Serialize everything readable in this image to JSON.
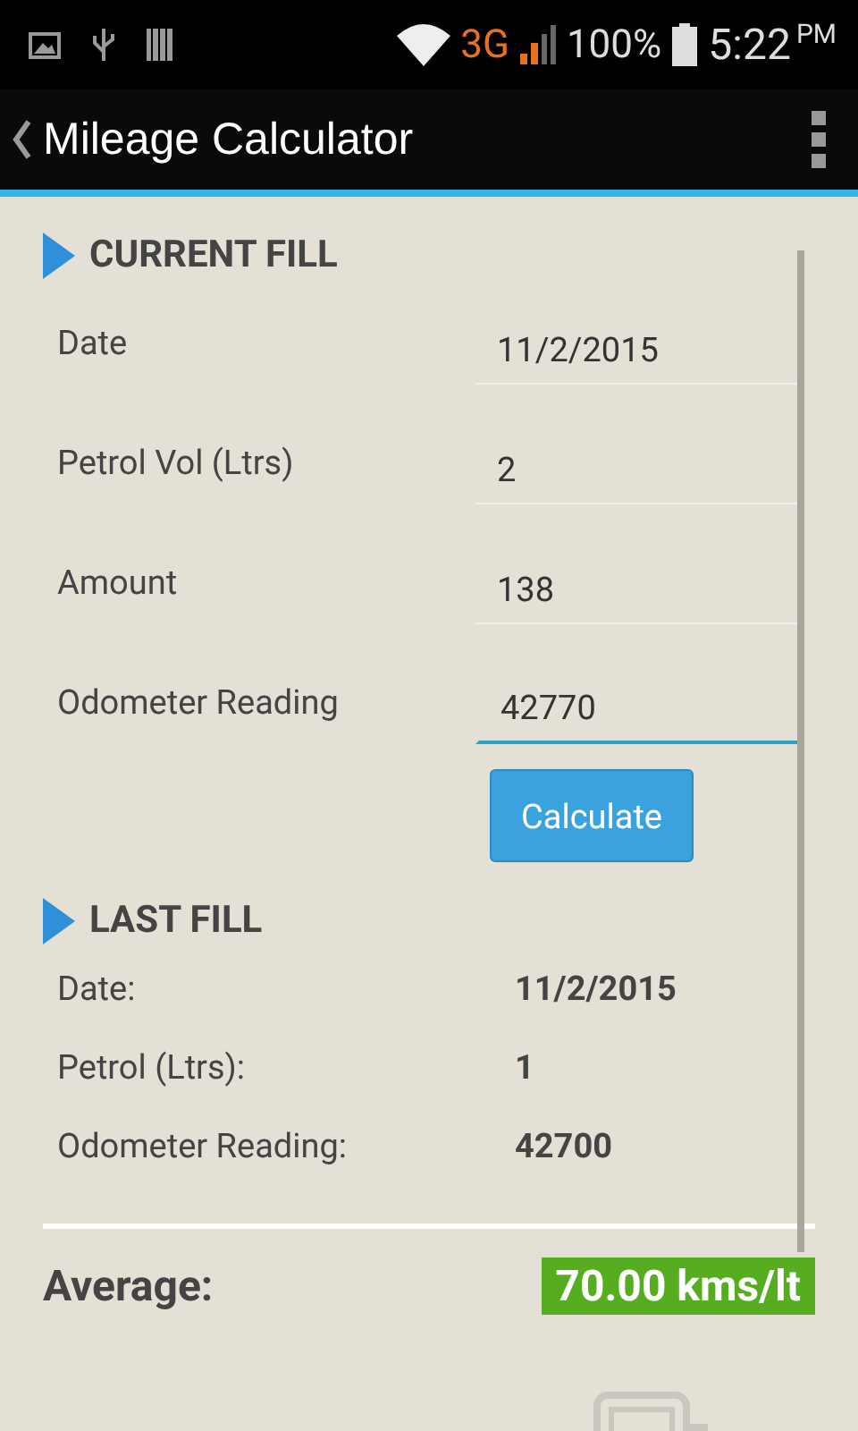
{
  "status_bar": {
    "network": "3G",
    "battery": "100%",
    "time": "5:22",
    "ampm": "PM"
  },
  "action_bar": {
    "title": "Mileage Calculator"
  },
  "current_fill": {
    "heading": "CURRENT FILL",
    "fields": [
      {
        "label": "Date",
        "value": "11/2/2015",
        "focused": false
      },
      {
        "label": "Petrol Vol (Ltrs)",
        "value": "2",
        "focused": false
      },
      {
        "label": "Amount",
        "value": "138",
        "focused": false
      },
      {
        "label": "Odometer Reading",
        "value": "42770",
        "focused": true
      }
    ],
    "button": "Calculate"
  },
  "last_fill": {
    "heading": "LAST FILL",
    "rows": [
      {
        "label": "Date:",
        "value": "11/2/2015"
      },
      {
        "label": "Petrol (Ltrs):",
        "value": "1"
      },
      {
        "label": "Odometer Reading:",
        "value": "42700"
      }
    ]
  },
  "average": {
    "label": "Average:",
    "value": "70.00 kms/lt"
  }
}
